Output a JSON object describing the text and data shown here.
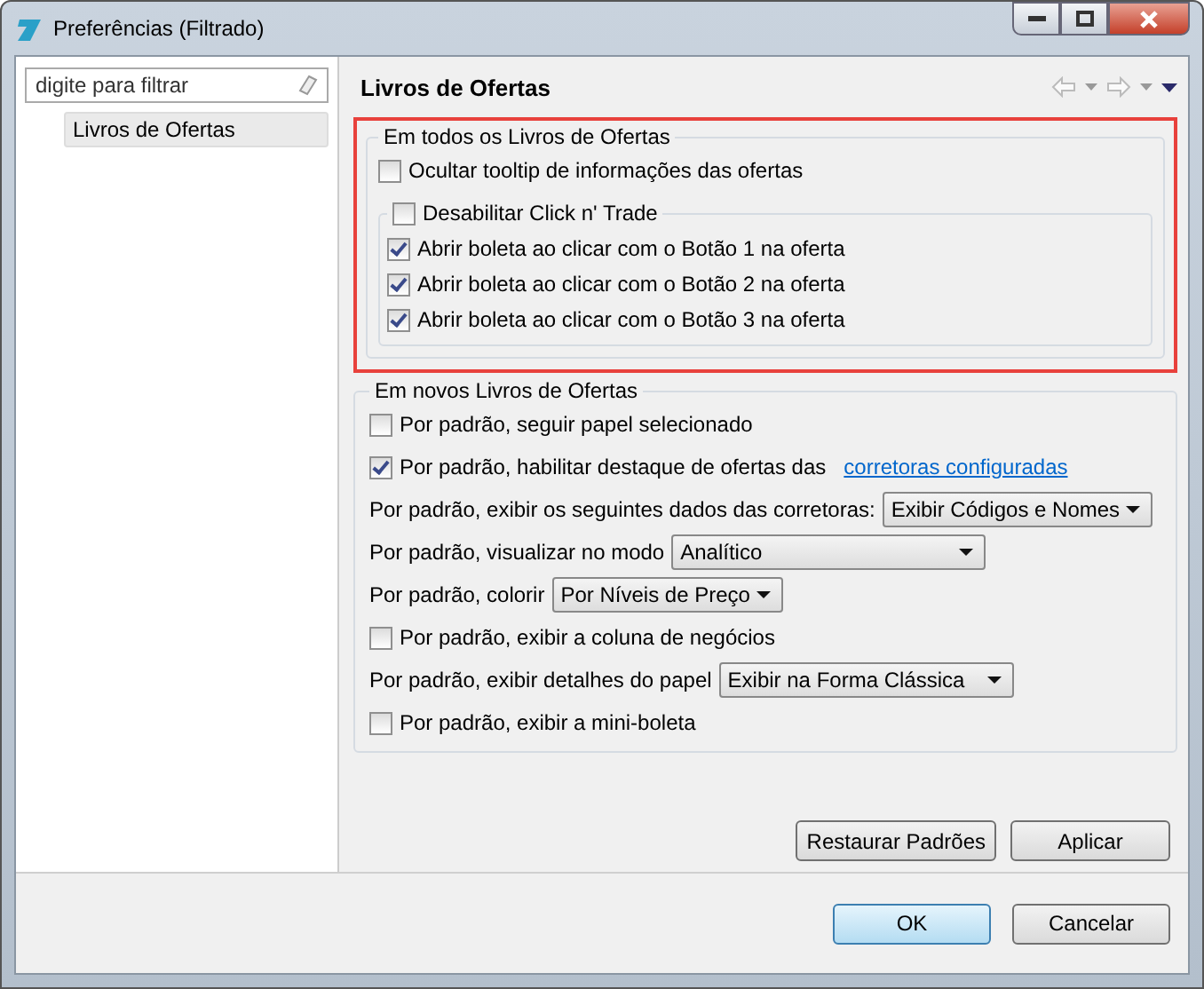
{
  "window": {
    "title": "Preferências (Filtrado)"
  },
  "filter": {
    "placeholder": "digite para filtrar"
  },
  "tree": [
    {
      "label": "Livros de Ofertas",
      "selected": true
    }
  ],
  "page": {
    "title": "Livros de Ofertas"
  },
  "group_all": {
    "title": "Em todos os Livros de Ofertas",
    "highlighted": true,
    "option": {
      "label": "Ocultar tooltip de informações das ofertas",
      "checked": false
    },
    "subgroup": {
      "label": "Desabilitar Click n' Trade",
      "checked": false,
      "items": [
        {
          "label": "Abrir boleta ao clicar com o Botão 1 na oferta",
          "checked": true
        },
        {
          "label": "Abrir boleta ao clicar com o Botão 2 na oferta",
          "checked": true
        },
        {
          "label": "Abrir boleta ao clicar com o Botão 3 na oferta",
          "checked": true
        }
      ]
    }
  },
  "group_new": {
    "title": "Em novos Livros de Ofertas",
    "rows": [
      {
        "kind": "checkbox",
        "label": "Por padrão, seguir papel selecionado",
        "checked": false
      },
      {
        "kind": "checkbox_link",
        "label": "Por padrão, habilitar destaque de ofertas das",
        "link": "corretoras configuradas",
        "checked": true
      },
      {
        "kind": "select",
        "label": "Por padrão, exibir os seguintes dados das corretoras:",
        "value": "Exibir Códigos e Nomes"
      },
      {
        "kind": "select",
        "label": "Por padrão, visualizar no modo",
        "value": "Analítico"
      },
      {
        "kind": "select",
        "label": "Por padrão, colorir",
        "value": "Por Níveis de Preço"
      },
      {
        "kind": "checkbox",
        "label": "Por padrão, exibir a coluna de negócios",
        "checked": false
      },
      {
        "kind": "select",
        "label": "Por padrão, exibir detalhes do papel",
        "value": "Exibir na Forma Clássica"
      },
      {
        "kind": "checkbox",
        "label": "Por padrão, exibir a mini-boleta",
        "checked": false
      }
    ]
  },
  "page_buttons": [
    "Restaurar Padrões",
    "Aplicar"
  ],
  "dialog_buttons": [
    {
      "label": "OK",
      "default": true
    },
    {
      "label": "Cancelar",
      "default": false
    }
  ]
}
